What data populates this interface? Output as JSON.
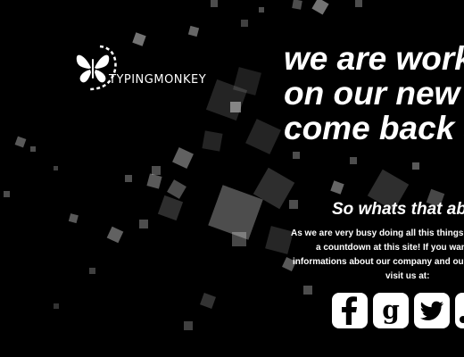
{
  "logo": {
    "text": "TYPINGMONKEY",
    "icon": "butterfly-icon"
  },
  "headline": {
    "line1": "we are working",
    "line2": "on our new website",
    "line3": "come back soon"
  },
  "subhead": "So whats that about?",
  "body": {
    "line1": "As we are very busy doing all this things, we've set up",
    "line2": "a countdown at this site! If you want some",
    "line3": "informations about our company and our clients, please",
    "line4": "visit us at:"
  },
  "social": [
    {
      "name": "facebook",
      "icon": "facebook-icon",
      "glyph": "f"
    },
    {
      "name": "google",
      "icon": "google-icon",
      "glyph": "g"
    },
    {
      "name": "twitter",
      "icon": "twitter-icon",
      "glyph": "bird"
    },
    {
      "name": "other",
      "icon": "social-icon",
      "glyph": "j"
    }
  ],
  "colors": {
    "background": "#000000",
    "text": "#ffffff",
    "squares": "#ffffff"
  }
}
